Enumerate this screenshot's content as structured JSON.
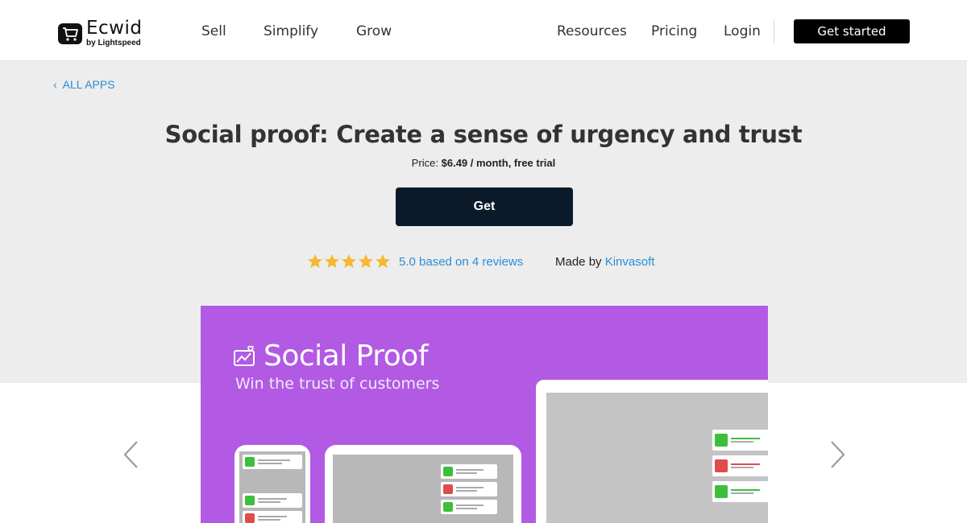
{
  "header": {
    "brand": "Ecwid",
    "brand_sub": "by Lightspeed",
    "nav": [
      "Sell",
      "Simplify",
      "Grow"
    ],
    "nav_right": [
      "Resources",
      "Pricing",
      "Login"
    ],
    "cta": "Get started"
  },
  "hero": {
    "back_label": "ALL APPS",
    "title": "Social proof: Create a sense of urgency and trust",
    "price_label": "Price:",
    "price_value": "$6.49 / month, free trial",
    "get_label": "Get",
    "rating_stars": 5,
    "rating_text": "5.0 based on 4 reviews",
    "made_by_label": "Made by",
    "made_by_vendor": "Kinvasoft"
  },
  "gallery": {
    "slide_title": "Social Proof",
    "slide_subtitle": "Win the trust of customers",
    "background": "#b25ae3"
  },
  "colors": {
    "link": "#2a8dd6",
    "button_dark": "#0b1a2a",
    "star": "#f5b82e",
    "hero_bg": "#ededed"
  }
}
